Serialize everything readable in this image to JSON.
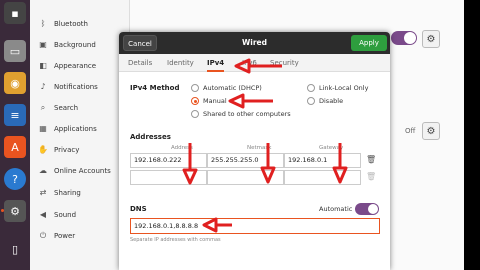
{
  "sidebar": {
    "items": [
      {
        "label": "Bluetooth",
        "icon": "bluetooth-icon"
      },
      {
        "label": "Background",
        "icon": "image-icon"
      },
      {
        "label": "Appearance",
        "icon": "appearance-icon"
      },
      {
        "label": "Notifications",
        "icon": "bell-icon"
      },
      {
        "label": "Search",
        "icon": "search-icon"
      },
      {
        "label": "Applications",
        "icon": "apps-icon"
      },
      {
        "label": "Privacy",
        "icon": "lock-icon"
      },
      {
        "label": "Online Accounts",
        "icon": "cloud-icon"
      },
      {
        "label": "Sharing",
        "icon": "share-icon"
      },
      {
        "label": "Sound",
        "icon": "speaker-icon"
      },
      {
        "label": "Power",
        "icon": "power-icon"
      }
    ]
  },
  "background_panel": {
    "off_label": "Off"
  },
  "dialog": {
    "title": "Wired",
    "cancel_label": "Cancel",
    "apply_label": "Apply",
    "tabs": [
      "Details",
      "Identity",
      "IPv4",
      "IPv6",
      "Security"
    ],
    "active_tab": "IPv4",
    "ipv4_method": {
      "label": "IPv4 Method",
      "options": [
        "Automatic (DHCP)",
        "Link-Local Only",
        "Manual",
        "Disable",
        "Shared to other computers"
      ],
      "selected": "Manual"
    },
    "addresses": {
      "label": "Addresses",
      "columns": [
        "Address",
        "Netmask",
        "Gateway"
      ],
      "rows": [
        [
          "192.168.0.222",
          "255.255.255.0",
          "192.168.0.1"
        ],
        [
          "",
          "",
          ""
        ]
      ]
    },
    "dns": {
      "label": "DNS",
      "automatic_label": "Automatic",
      "automatic_on": true,
      "value": "192.168.0.1,8.8.8.8",
      "hint": "Separate IP addresses with commas"
    }
  },
  "colors": {
    "accent": "#e95420",
    "apply": "#2e9e3e",
    "toggle": "#7a4a8a",
    "annotation": "#e02020"
  }
}
